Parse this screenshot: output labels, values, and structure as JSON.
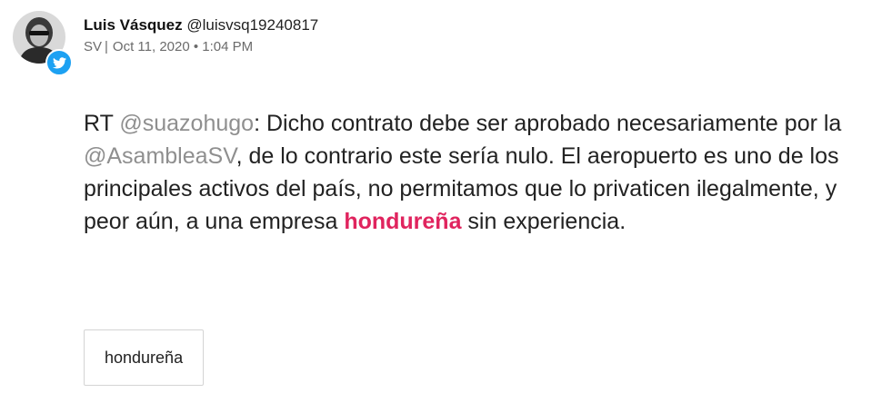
{
  "user": {
    "display_name": "Luis Vásquez",
    "handle": "@luisvsq19240817"
  },
  "meta": {
    "country": "SV",
    "separator": "|",
    "date": "Oct 11, 2020 • 1:04 PM"
  },
  "tweet": {
    "prefix": "RT ",
    "mention_1": "@suazohugo",
    "text_1": ": Dicho contrato debe ser aprobado necesariamente por la ",
    "mention_2": "@AsambleaSV",
    "text_2": ", de lo contrario este sería nulo. El aeropuerto es uno de los principales activos del país, no permitamos que lo privaticen ilegalmente, y peor aún, a una empresa ",
    "highlight": "hondureña",
    "text_3": " sin experiencia."
  },
  "tag": {
    "label": "hondureña"
  },
  "icons": {
    "avatar": "avatar",
    "badge": "twitter-bird-icon"
  },
  "colors": {
    "twitter_blue": "#1da1f2",
    "highlight": "#e0245e",
    "mention": "#8f8f8f",
    "meta": "#6b6b6b"
  }
}
